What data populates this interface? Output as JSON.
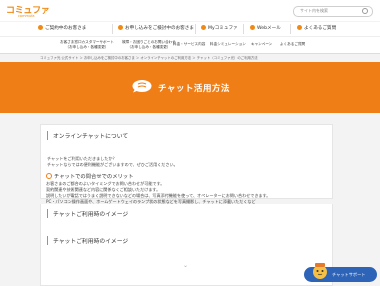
{
  "header": {
    "logo": "コミュファ",
    "logo_sub": "commufa",
    "search_placeholder": "サイト内を検索"
  },
  "nav_primary": [
    {
      "label": "ご契約中のお客さま"
    },
    {
      "label": "お申し込みをご検討中のお客さま"
    },
    {
      "label": "Myコミュファ"
    },
    {
      "label": "Webメール"
    },
    {
      "label": "よくあるご質問"
    }
  ],
  "nav_secondary": [
    {
      "label": "お客さま窓口カスタマーサポート",
      "sub": "（お申し込み・各種変更）"
    },
    {
      "label": "故障・お困りごとのお問い合わせ",
      "sub": "（お申し込み・各種変更）"
    },
    {
      "label": "料金・サービス内容"
    },
    {
      "label": "料金シミュレーション"
    },
    {
      "label": "キャンペーン"
    },
    {
      "label": "よくあるご質問"
    }
  ],
  "breadcrumb": "コミュファ光 公式サイト ＞ お申し込みをご検討中のお客さま ＞ オンラインチャットのご利用方法 ＞ チャット（コミュファ光）のご利用方法",
  "banner": {
    "title": "チャット活用方法"
  },
  "section1": {
    "title": "オンラインチャットについて",
    "lines": [
      "チャットをご利用いただきましたか？",
      "チャットならではの便利機能がございますので、ぜひご活用ください。"
    ],
    "subheading": "チャットでの問合せでのメリット",
    "details": [
      "お客さまのご都合のよいタイミングでお問い合わせが可能です。",
      "契約関連や技術関連など内容に関係なくご相談いただけます。",
      "説明したいが電話ではうまく説明できないなどの場合は、写真添付機能を使って、オペレーターにお問い合わせできます。",
      "PC・パソコン操作画面や、ホームゲートウェイのランプ状の状態などを写真撮影し、チャットに添載いただくなど"
    ]
  },
  "section2": {
    "title": "チャットご利用時のイメージ"
  },
  "support_widget": {
    "label": "チャットサポート"
  }
}
